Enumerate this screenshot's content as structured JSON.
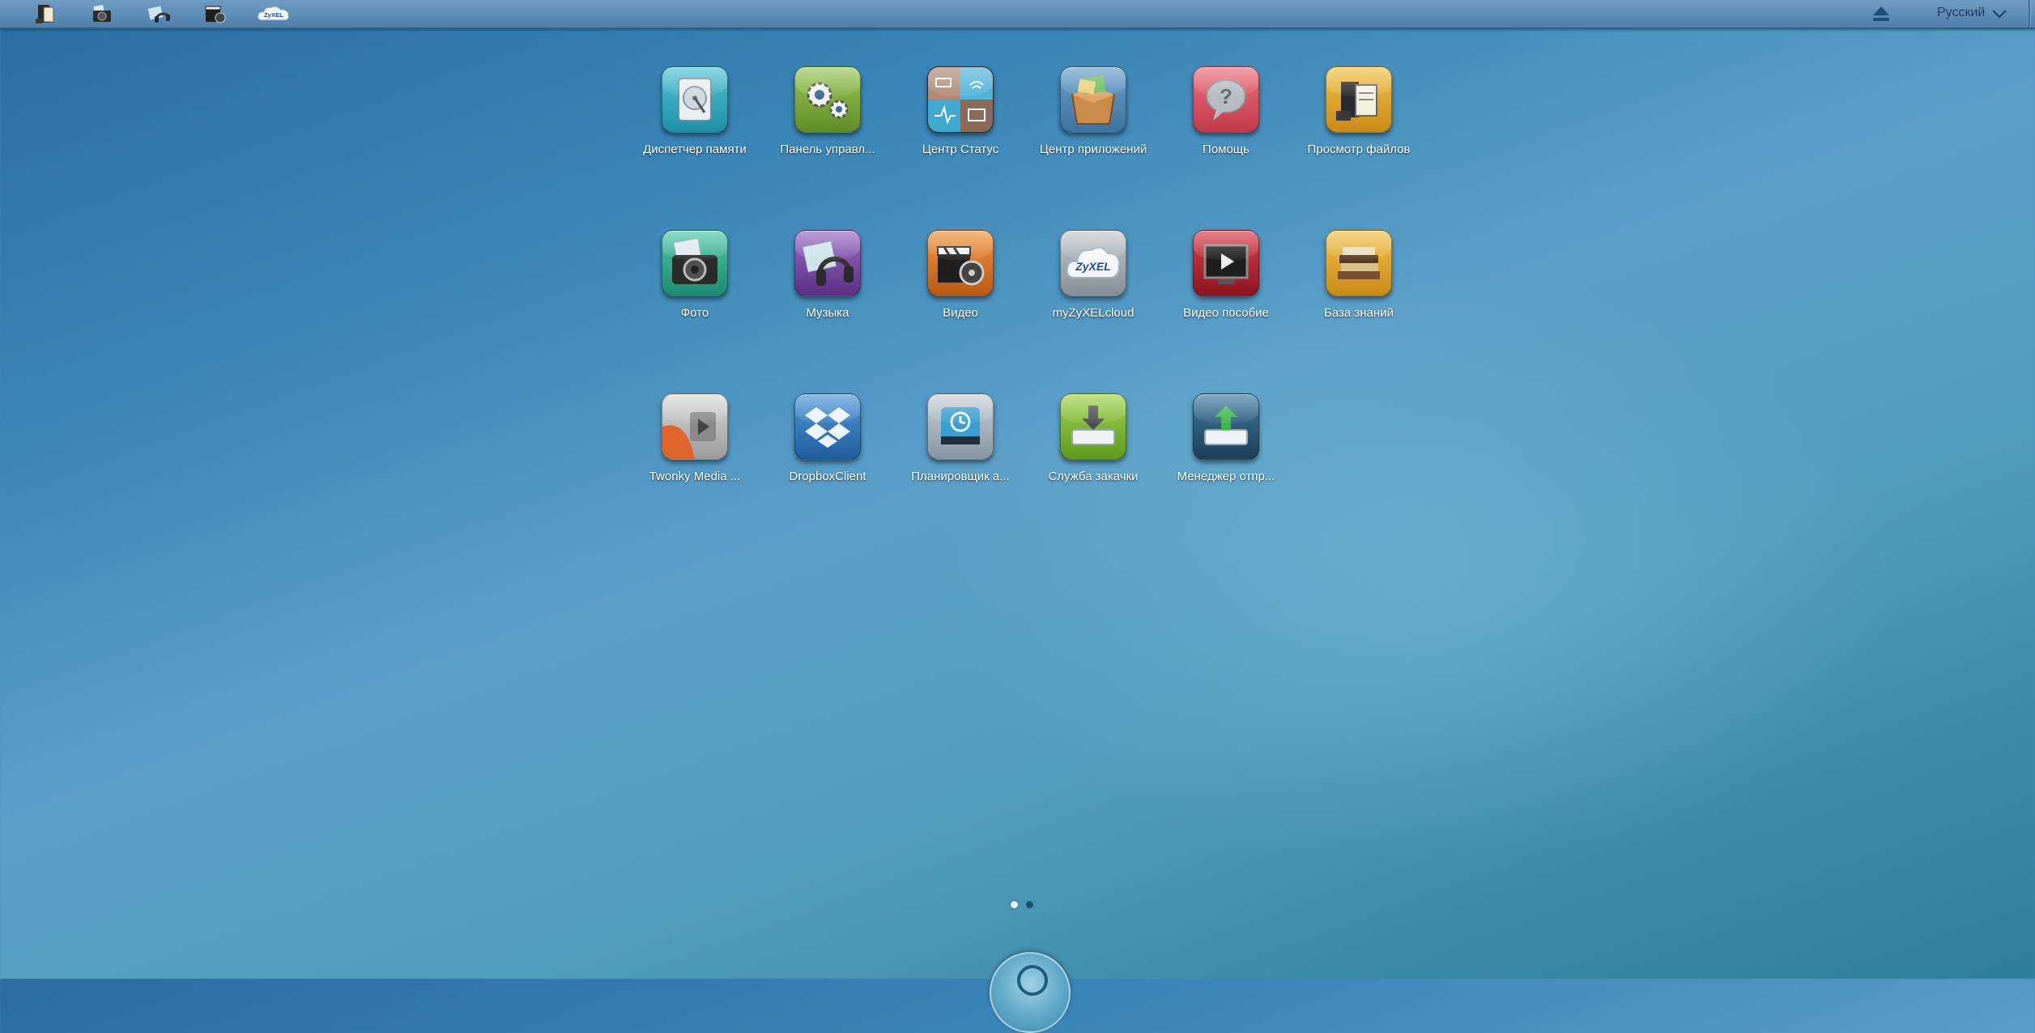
{
  "topbar": {
    "shortcuts": [
      {
        "name": "file-browser-shortcut",
        "icon": "file-browser-icon"
      },
      {
        "name": "photo-shortcut",
        "icon": "camera-icon"
      },
      {
        "name": "music-shortcut",
        "icon": "music-icon"
      },
      {
        "name": "video-shortcut",
        "icon": "video-clapper-icon"
      },
      {
        "name": "zyxel-cloud-shortcut",
        "icon": "zyxel-cloud-icon"
      }
    ],
    "zyxel_text": "ZyXEL",
    "language": "Русский"
  },
  "apps": [
    {
      "label": "Диспетчер памяти",
      "icon": "hard-disk-icon",
      "color": "#2f9fb5"
    },
    {
      "label": "Панель управл...",
      "icon": "gears-icon",
      "color": "#79a83a"
    },
    {
      "label": "Центр Статус",
      "icon": "status-grid-icon",
      "color": "#4aa3c8"
    },
    {
      "label": "Центр приложений",
      "icon": "app-box-icon",
      "color": "#4f86b3"
    },
    {
      "label": "Помощь",
      "icon": "help-bubble-icon",
      "color": "#d94e5e"
    },
    {
      "label": "Просмотр файлов",
      "icon": "file-browser-icon",
      "color": "#e0a72a"
    },
    {
      "label": "Фото",
      "icon": "camera-icon",
      "color": "#2ea58b"
    },
    {
      "label": "Музыка",
      "icon": "headphones-icon",
      "color": "#7b4aa3"
    },
    {
      "label": "Видео",
      "icon": "video-clapper-icon",
      "color": "#d9762a"
    },
    {
      "label": "myZyXELcloud",
      "icon": "zyxel-cloud-icon",
      "color": "#9aa4ad"
    },
    {
      "label": "Видео пособие",
      "icon": "video-tutorial-icon",
      "color": "#b0222e"
    },
    {
      "label": "База знаний",
      "icon": "books-icon",
      "color": "#e0a72a"
    },
    {
      "label": "Twonky Media ...",
      "icon": "twonky-icon",
      "color": "#c9c9c9"
    },
    {
      "label": "DropboxClient",
      "icon": "dropbox-icon",
      "color": "#2d72b8"
    },
    {
      "label": "Планировщик а...",
      "icon": "backup-scheduler-icon",
      "color": "#9aa8b4"
    },
    {
      "label": "Служба закачки",
      "icon": "download-service-icon",
      "color": "#7db536"
    },
    {
      "label": "Менеджер отпр...",
      "icon": "upload-manager-icon",
      "color": "#2c5c7c"
    }
  ],
  "pagination": {
    "current": 1,
    "total": 2
  }
}
